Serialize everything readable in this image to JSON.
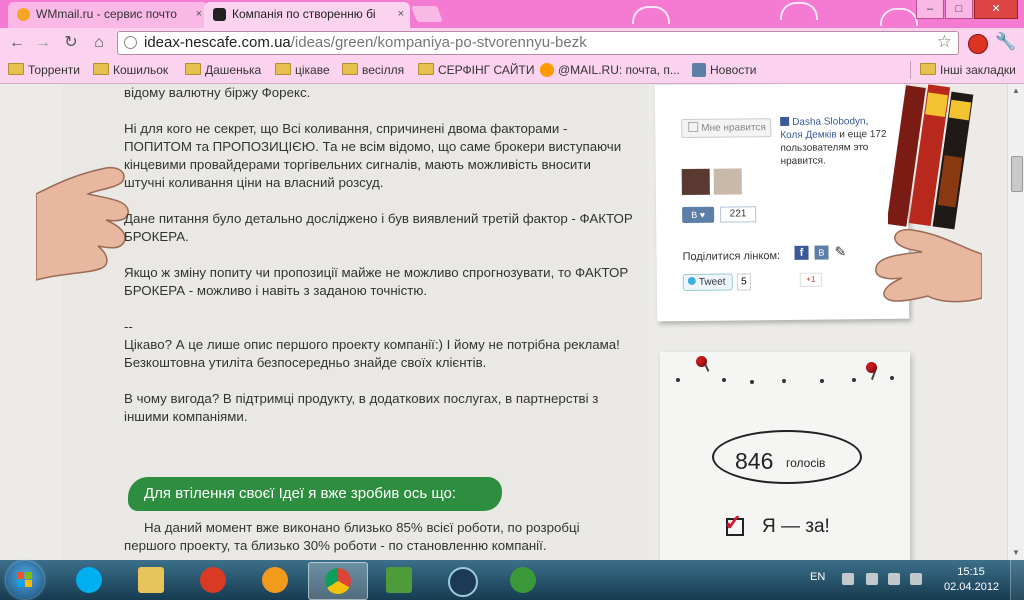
{
  "browser": {
    "tabs": [
      {
        "title": "WMmail.ru - сервис почто",
        "close": "×"
      },
      {
        "title": "Компанія по створенню бі",
        "close": "×"
      }
    ],
    "url_host": "ideax-nescafe.com.ua",
    "url_path": "/ideas/green/kompaniya-po-stvorennyu-bezk",
    "bookmarks": [
      "Торренти",
      "Кошильок",
      "Дашенька",
      "цікаве",
      "весілля",
      "СЕРФІНГ САЙТИ",
      "@MAIL.RU: почта, п...",
      "Новости"
    ],
    "bookmarks_other": "Інші закладки",
    "window_buttons": {
      "minimize": "–",
      "maximize": "□",
      "close": "✕"
    }
  },
  "article": {
    "intro": "відому валютну біржу Форекс.",
    "p1": "Ні для кого не секрет, що Всі коливання, спричинені двома факторами - ПОПИТОМ та ПРОПОЗИЦІЄЮ. Та не всім відомо, що саме брокери виступаючи кінцевими провайдерами торгівельних сигналів, мають можливість вносити штучні коливання ціни на власний розсуд.",
    "p2": "Дане питання було детально досліджено і був виявлений третій фактор - ФАКТОР БРОКЕРА.",
    "p3": "Якщо ж зміну попиту чи пропозиції майже не можливо спрогнозувати, то ФАКТОР БРОКЕРА - можливо і навіть з заданою точністю.",
    "sep": "--",
    "p4a": "Цікаво? А це лише опис першого проекту компанії:) І йому не потрібна реклама!",
    "p4b": "Безкоштовна утиліта безпосередньо знайде своїх клієнтів.",
    "p5": "В чому вигода? В підтримці продукту, в додаткових послугах, в партнерстві з іншими компаніями.",
    "banner": "Для втілення своєї Ідеї я вже зробив ось що:",
    "after": "На даний момент вже виконано близько 85% всієї роботи, по розробці першого проекту, та близько 30% роботи - по становленню компанії."
  },
  "social": {
    "like_button": "Мне нравится",
    "liker1": "Dasha Slobodyn",
    "liker2": "Коля Демків",
    "likers_text": "и еще 172 пользователям это нравится.",
    "vk_label": "В",
    "vk_count": "221",
    "share_label": "Поділитися лінком:",
    "share_fb": "f",
    "share_vk": "В",
    "tweet": "Tweet",
    "tweet_count": "5",
    "gplus": "+1"
  },
  "vote": {
    "count": "846",
    "unit": "голосів",
    "label": "Я — за!"
  },
  "taskbar": {
    "lang": "EN",
    "time": "15:15",
    "date": "02.04.2012"
  },
  "colors": {
    "chrome_pink": "#f57ad2",
    "banner_green": "#2d8e3f",
    "pin_red": "#c61a1a",
    "check_red": "#d3172b"
  }
}
